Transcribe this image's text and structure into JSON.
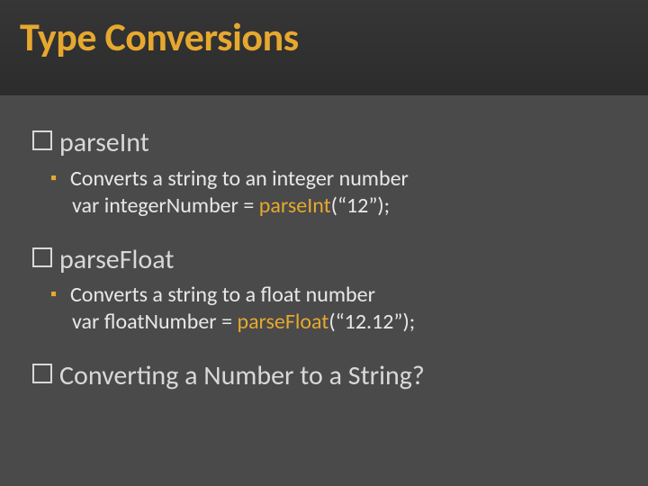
{
  "title": "Type Conversions",
  "items": [
    {
      "heading": "parseInt",
      "desc": "Converts a string to an integer number",
      "code_pre": "var integerNumber = ",
      "code_fn": "parseInt",
      "code_post": "(“12”);"
    },
    {
      "heading": "parseFloat",
      "desc": "Converts a string to a float number",
      "code_pre": "var floatNumber = ",
      "code_fn": "parseFloat",
      "code_post": "(“12.12”);"
    }
  ],
  "question": "Converting a Number to a String?"
}
